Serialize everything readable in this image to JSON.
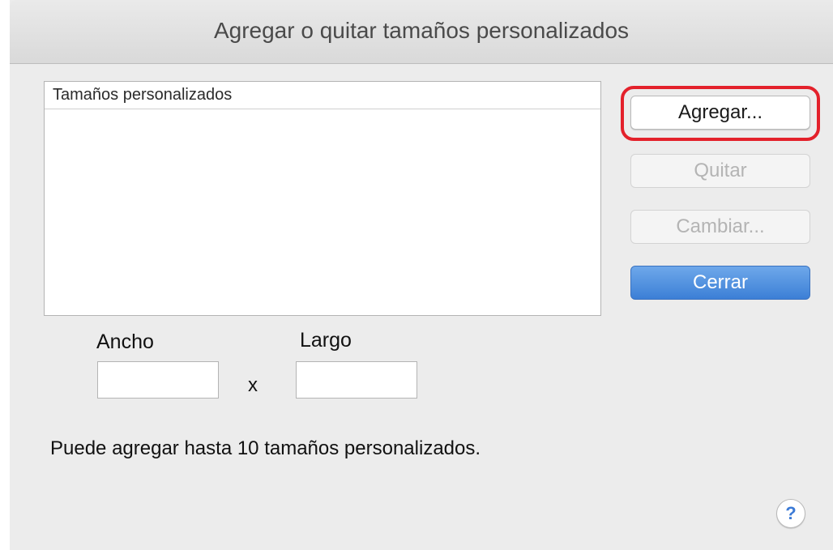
{
  "window": {
    "title": "Agregar o quitar tamaños personalizados"
  },
  "list": {
    "header": "Tamaños personalizados",
    "items": []
  },
  "buttons": {
    "add": "Agregar...",
    "remove": "Quitar",
    "change": "Cambiar...",
    "close": "Cerrar"
  },
  "size": {
    "width_label": "Ancho",
    "length_label": "Largo",
    "separator": "x",
    "width_value": "",
    "length_value": ""
  },
  "info_text": "Puede agregar hasta 10 tamaños personalizados.",
  "help": {
    "icon": "help-icon",
    "glyph": "?"
  },
  "colors": {
    "highlight": "#e3212b",
    "default_button": "#3c7fd6"
  }
}
